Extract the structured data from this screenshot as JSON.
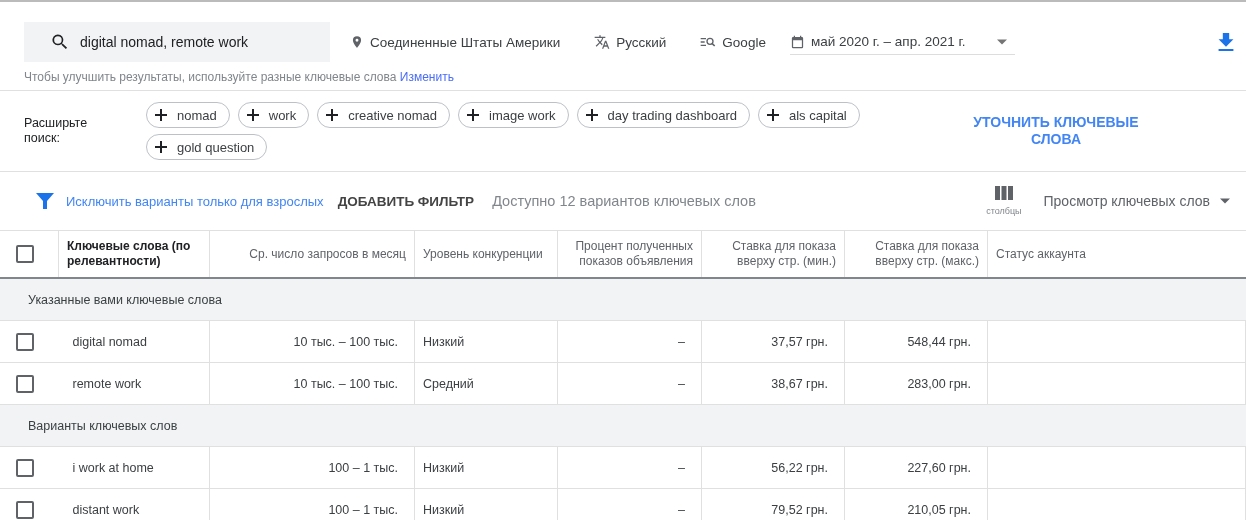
{
  "search": {
    "value": "digital nomad, remote work"
  },
  "settings": [
    {
      "kind": "location",
      "label": "Соединенные Штаты Америки"
    },
    {
      "kind": "language",
      "label": "Русский"
    },
    {
      "kind": "network",
      "label": "Google"
    }
  ],
  "date_range": {
    "label": "май 2020 г. – апр. 2021 г."
  },
  "hint": {
    "text": "Чтобы улучшить результаты, используйте разные ключевые слова",
    "link": "Изменить"
  },
  "broaden": {
    "label": "Расширьте поиск:",
    "chips": [
      "nomad",
      "work",
      "creative nomad",
      "image work",
      "day trading dashboard",
      "als capital",
      "gold question"
    ],
    "refine": "УТОЧНИТЬ КЛЮЧЕВЫЕ СЛОВА"
  },
  "filter_bar": {
    "exclude_adult": "Исключить варианты только для взрослых",
    "add_filter": "ДОБАВИТЬ ФИЛЬТР",
    "available": "Доступно 12 вариантов ключевых слов",
    "columns": "столбцы",
    "view": "Просмотр ключевых слов"
  },
  "table": {
    "select_all": {
      "checked": false
    },
    "columns": [
      "Ключевые слова (по релевантности)",
      "Ср. число запросов в месяц",
      "Уровень конкуренции",
      "Процент полученных показов объявления",
      "Ставка для показа вверху стр. (мин.)",
      "Ставка для показа вверху стр. (макс.)",
      "Статус аккаунта"
    ],
    "groups": [
      {
        "title": "Указанные вами ключевые слова",
        "rows": [
          {
            "checked": false,
            "cells": [
              "digital nomad",
              "10 тыс. – 100 тыс.",
              "Низкий",
              "–",
              "37,57 грн.",
              "548,44 грн."
            ]
          },
          {
            "checked": false,
            "cells": [
              "remote work",
              "10 тыс. – 100 тыс.",
              "Средний",
              "–",
              "38,67 грн.",
              "283,00 грн."
            ]
          }
        ]
      },
      {
        "title": "Варианты ключевых слов",
        "rows": [
          {
            "checked": false,
            "cells": [
              "i work at home",
              "100 – 1 тыс.",
              "Низкий",
              "–",
              "56,22 грн.",
              "227,60 грн."
            ]
          },
          {
            "checked": false,
            "cells": [
              "distant work",
              "100 – 1 тыс.",
              "Низкий",
              "–",
              "79,52 грн.",
              "210,05 грн."
            ]
          }
        ]
      }
    ]
  }
}
